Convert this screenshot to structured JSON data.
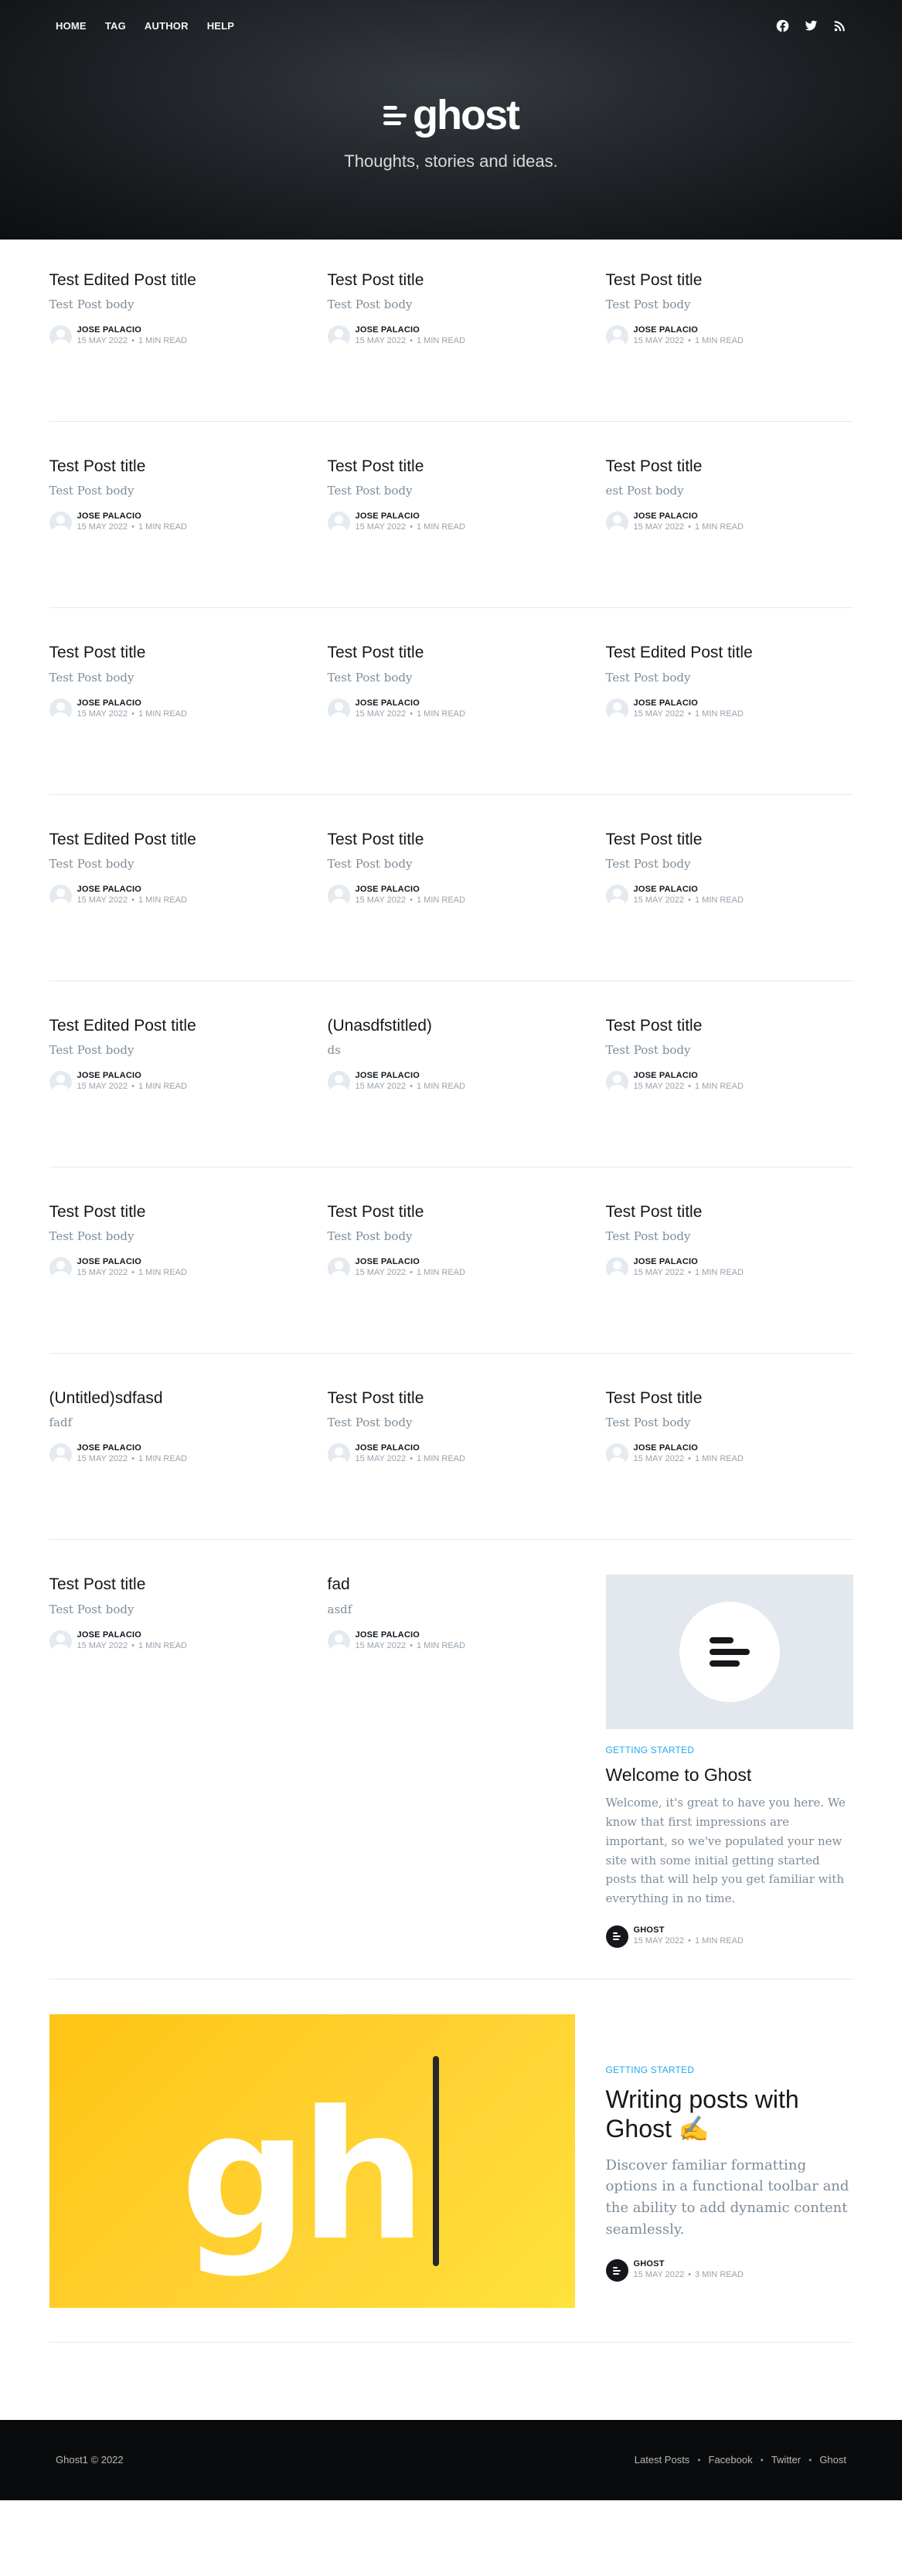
{
  "nav": {
    "links": [
      "HOME",
      "TAG",
      "AUTHOR",
      "HELP"
    ],
    "social_icons": [
      "facebook-icon",
      "twitter-icon",
      "rss-icon"
    ]
  },
  "header": {
    "brand": "ghost",
    "tagline": "Thoughts, stories and ideas."
  },
  "posts": [
    [
      {
        "title": "Test Edited Post title",
        "excerpt": "Test Post body",
        "author": "JOSE PALACIO",
        "date": "15 MAY 2022",
        "read": "1 MIN READ"
      },
      {
        "title": "Test Post title",
        "excerpt": "Test Post body",
        "author": "JOSE PALACIO",
        "date": "15 MAY 2022",
        "read": "1 MIN READ"
      },
      {
        "title": "Test Post title",
        "excerpt": "Test Post body",
        "author": "JOSE PALACIO",
        "date": "15 MAY 2022",
        "read": "1 MIN READ"
      }
    ],
    [
      {
        "title": "Test Post title",
        "excerpt": "Test Post body",
        "author": "JOSE PALACIO",
        "date": "15 MAY 2022",
        "read": "1 MIN READ"
      },
      {
        "title": "Test Post title",
        "excerpt": "Test Post body",
        "author": "JOSE PALACIO",
        "date": "15 MAY 2022",
        "read": "1 MIN READ"
      },
      {
        "title": "Test Post title",
        "excerpt": "est Post body",
        "author": "JOSE PALACIO",
        "date": "15 MAY 2022",
        "read": "1 MIN READ"
      }
    ],
    [
      {
        "title": "Test Post title",
        "excerpt": "Test Post body",
        "author": "JOSE PALACIO",
        "date": "15 MAY 2022",
        "read": "1 MIN READ"
      },
      {
        "title": "Test Post title",
        "excerpt": "Test Post body",
        "author": "JOSE PALACIO",
        "date": "15 MAY 2022",
        "read": "1 MIN READ"
      },
      {
        "title": "Test Edited Post title",
        "excerpt": "Test Post body",
        "author": "JOSE PALACIO",
        "date": "15 MAY 2022",
        "read": "1 MIN READ"
      }
    ],
    [
      {
        "title": "Test Edited Post title",
        "excerpt": "Test Post body",
        "author": "JOSE PALACIO",
        "date": "15 MAY 2022",
        "read": "1 MIN READ"
      },
      {
        "title": "Test Post title",
        "excerpt": "Test Post body",
        "author": "JOSE PALACIO",
        "date": "15 MAY 2022",
        "read": "1 MIN READ"
      },
      {
        "title": "Test Post title",
        "excerpt": "Test Post body",
        "author": "JOSE PALACIO",
        "date": "15 MAY 2022",
        "read": "1 MIN READ"
      }
    ],
    [
      {
        "title": "Test Edited Post title",
        "excerpt": "Test Post body",
        "author": "JOSE PALACIO",
        "date": "15 MAY 2022",
        "read": "1 MIN READ"
      },
      {
        "title": "(Unasdfstitled)",
        "excerpt": "ds",
        "author": "JOSE PALACIO",
        "date": "15 MAY 2022",
        "read": "1 MIN READ"
      },
      {
        "title": "Test Post title",
        "excerpt": "Test Post body",
        "author": "JOSE PALACIO",
        "date": "15 MAY 2022",
        "read": "1 MIN READ"
      }
    ],
    [
      {
        "title": "Test Post title",
        "excerpt": "Test Post body",
        "author": "JOSE PALACIO",
        "date": "15 MAY 2022",
        "read": "1 MIN READ"
      },
      {
        "title": "Test Post title",
        "excerpt": "Test Post body",
        "author": "JOSE PALACIO",
        "date": "15 MAY 2022",
        "read": "1 MIN READ"
      },
      {
        "title": "Test Post title",
        "excerpt": "Test Post body",
        "author": "JOSE PALACIO",
        "date": "15 MAY 2022",
        "read": "1 MIN READ"
      }
    ],
    [
      {
        "title": "(Untitled)sdfasd",
        "excerpt": "fadf",
        "author": "JOSE PALACIO",
        "date": "15 MAY 2022",
        "read": "1 MIN READ"
      },
      {
        "title": "Test Post title",
        "excerpt": "Test Post body",
        "author": "JOSE PALACIO",
        "date": "15 MAY 2022",
        "read": "1 MIN READ"
      },
      {
        "title": "Test Post title",
        "excerpt": "Test Post body",
        "author": "JOSE PALACIO",
        "date": "15 MAY 2022",
        "read": "1 MIN READ"
      }
    ]
  ],
  "last_row": [
    {
      "title": "Test Post title",
      "excerpt": "Test Post body",
      "author": "JOSE PALACIO",
      "date": "15 MAY 2022",
      "read": "1 MIN READ"
    },
    {
      "title": "fad",
      "excerpt": "asdf",
      "author": "JOSE PALACIO",
      "date": "15 MAY 2022",
      "read": "1 MIN READ"
    }
  ],
  "welcome": {
    "tag": "GETTING STARTED",
    "title": "Welcome to Ghost",
    "excerpt": "Welcome, it's great to have you here. We know that first impressions are important, so we've populated your new site with some initial getting started posts that will help you get familiar with everything in no time.",
    "author": "GHOST",
    "date": "15 MAY 2022",
    "read": "1 MIN READ"
  },
  "writing": {
    "tag": "GETTING STARTED",
    "title": "Writing posts with Ghost ✍️",
    "image_text": "gh",
    "excerpt": "Discover familiar formatting options in a functional toolbar and the ability to add dynamic content seamlessly.",
    "author": "GHOST",
    "date": "15 MAY 2022",
    "read": "3 MIN READ"
  },
  "footer": {
    "copyright": "Ghost1 © 2022",
    "links": [
      "Latest Posts",
      "Facebook",
      "Twitter",
      "Ghost"
    ],
    "separator": "•"
  }
}
